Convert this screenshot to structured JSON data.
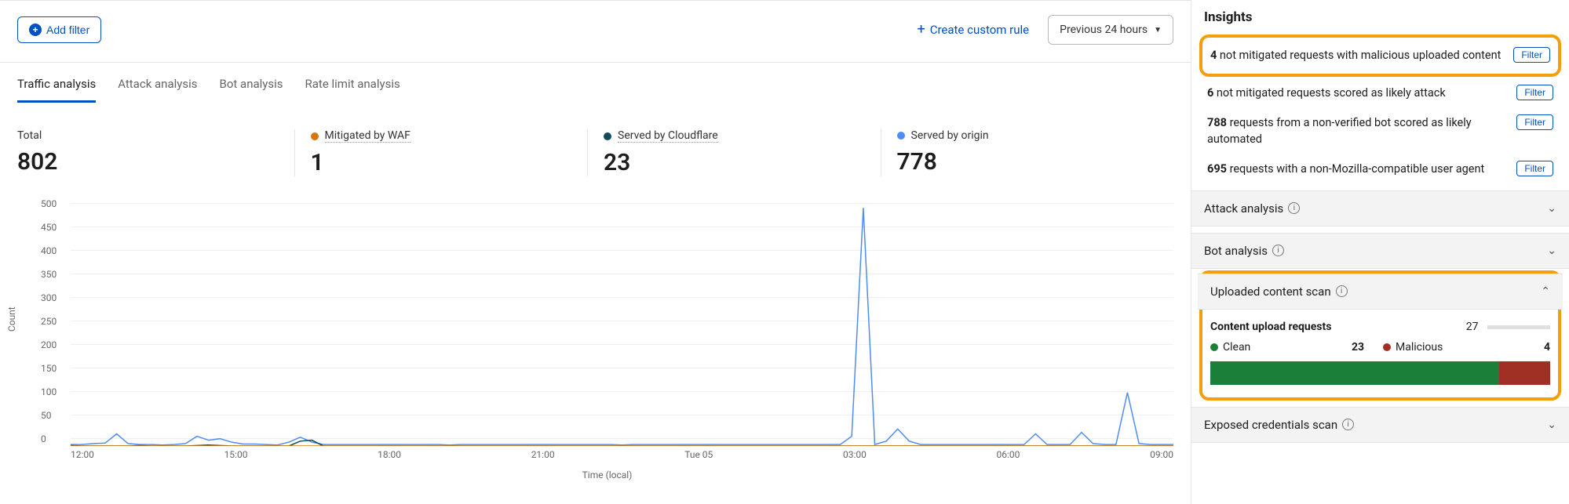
{
  "colors": {
    "mitigated": "#d97706",
    "cloudflare": "#0f4b5c",
    "origin": "#4f8df5",
    "clean": "#1b7f3a",
    "malicious": "#a03024"
  },
  "toolbar": {
    "add_filter": "Add filter",
    "create_rule": "Create custom rule",
    "time_range": "Previous 24 hours"
  },
  "tabs": [
    {
      "label": "Traffic analysis",
      "active": true
    },
    {
      "label": "Attack analysis",
      "active": false
    },
    {
      "label": "Bot analysis",
      "active": false
    },
    {
      "label": "Rate limit analysis",
      "active": false
    }
  ],
  "stats": {
    "total": {
      "label": "Total",
      "value": "802"
    },
    "waf": {
      "label": "Mitigated by WAF",
      "value": "1"
    },
    "cf": {
      "label": "Served by Cloudflare",
      "value": "23"
    },
    "origin": {
      "label": "Served by origin",
      "value": "778"
    }
  },
  "chart_data": {
    "type": "line",
    "title": "",
    "xlabel": "Time (local)",
    "ylabel": "Count",
    "ylim": [
      0,
      500
    ],
    "y_ticks": [
      0,
      50,
      100,
      150,
      200,
      250,
      300,
      350,
      400,
      450,
      500
    ],
    "x_ticks": [
      "12:00",
      "15:00",
      "18:00",
      "21:00",
      "Tue 05",
      "03:00",
      "06:00",
      "09:00"
    ],
    "series": [
      {
        "name": "Served by origin",
        "color": "#4f8df5",
        "values": [
          3,
          3,
          5,
          6,
          25,
          5,
          3,
          3,
          2,
          3,
          5,
          20,
          12,
          15,
          8,
          4,
          4,
          3,
          2,
          8,
          18,
          8,
          3,
          3,
          3,
          3,
          3,
          3,
          3,
          3,
          3,
          3,
          3,
          2,
          3,
          3,
          3,
          3,
          3,
          3,
          3,
          3,
          3,
          3,
          3,
          3,
          3,
          3,
          2,
          3,
          3,
          3,
          3,
          3,
          3,
          3,
          3,
          3,
          3,
          3,
          3,
          3,
          3,
          3,
          3,
          3,
          3,
          3,
          20,
          490,
          3,
          10,
          35,
          10,
          3,
          3,
          3,
          3,
          3,
          3,
          3,
          3,
          3,
          3,
          25,
          3,
          3,
          3,
          28,
          5,
          3,
          3,
          110,
          5,
          3,
          3,
          3
        ]
      },
      {
        "name": "Served by Cloudflare",
        "color": "#0f4b5c",
        "values": [
          1,
          0,
          0,
          0,
          0,
          0,
          1,
          0,
          0,
          0,
          0,
          1,
          2,
          1,
          0,
          0,
          0,
          0,
          0,
          0,
          10,
          12,
          0,
          0,
          0,
          0,
          0,
          0,
          0,
          0,
          0,
          0,
          0,
          0,
          0,
          0,
          0,
          0,
          0,
          0,
          0,
          0,
          0,
          0,
          0,
          0,
          0,
          0,
          0,
          0,
          0,
          0,
          0,
          0,
          0,
          0,
          0,
          0,
          0,
          0,
          0,
          0,
          0,
          0,
          0,
          0,
          0,
          0,
          0,
          0,
          0,
          0,
          0,
          0,
          0,
          0,
          0,
          0,
          0,
          0,
          0,
          0,
          0,
          0,
          0,
          0,
          0,
          0,
          0,
          0,
          0,
          0,
          0,
          0,
          0,
          0,
          0
        ]
      },
      {
        "name": "Mitigated by WAF",
        "color": "#d97706",
        "values": [
          0,
          0,
          0,
          0,
          0,
          0,
          0,
          0,
          0,
          0,
          0,
          0,
          0,
          0,
          0,
          0,
          0,
          0,
          0,
          0,
          0,
          0,
          0,
          0,
          0,
          0,
          0,
          0,
          0,
          0,
          0,
          0,
          0,
          0,
          0,
          0,
          0,
          0,
          0,
          0,
          0,
          0,
          0,
          0,
          0,
          0,
          0,
          0,
          0,
          0,
          0,
          0,
          0,
          0,
          0,
          0,
          0,
          0,
          0,
          0,
          0,
          0,
          0,
          0,
          0,
          0,
          0,
          0,
          0,
          0,
          0,
          0,
          0,
          0,
          0,
          0,
          0,
          0,
          0,
          0,
          0,
          0,
          0,
          0,
          0,
          0,
          0,
          0,
          0,
          0,
          0,
          0,
          0,
          0,
          0,
          0,
          0
        ]
      }
    ]
  },
  "insights": {
    "title": "Insights",
    "filter_label": "Filter",
    "items": [
      {
        "count": "4",
        "text": "not mitigated requests with malicious uploaded content",
        "highlight": true
      },
      {
        "count": "6",
        "text": "not mitigated requests scored as likely attack",
        "highlight": false
      },
      {
        "count": "788",
        "text": "requests from a non-verified bot scored as likely automated",
        "highlight": false
      },
      {
        "count": "695",
        "text": "requests with a non-Mozilla-compatible user agent",
        "highlight": false
      }
    ]
  },
  "accordions": {
    "attack": "Attack analysis",
    "bot": "Bot analysis",
    "upload": "Uploaded content scan",
    "exposed": "Exposed credentials scan"
  },
  "upload": {
    "title": "Content upload requests",
    "total": "27",
    "clean_label": "Clean",
    "clean_value": "23",
    "malicious_label": "Malicious",
    "malicious_value": "4",
    "clean_pct": 85,
    "mini_pct": 6
  }
}
